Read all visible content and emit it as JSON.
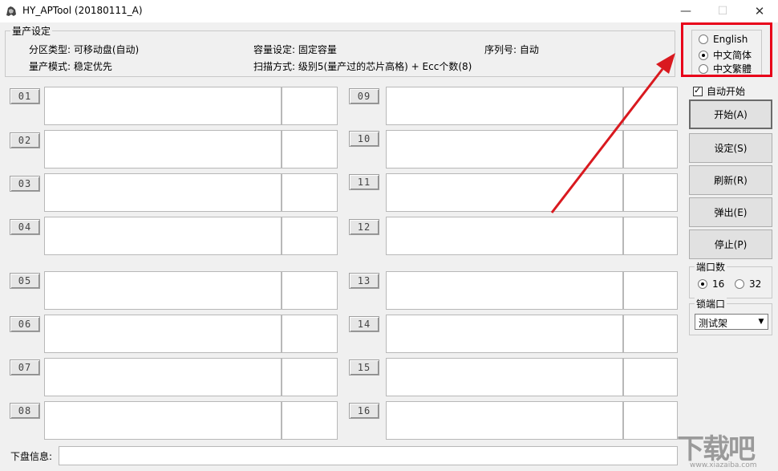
{
  "window": {
    "title": "HY_APTool (20180111_A)",
    "min_icon": "minimize-icon",
    "max_icon": "maximize-icon",
    "close_icon": "close-icon"
  },
  "production_settings": {
    "legend": "量产设定",
    "partition_type": "分区类型: 可移动盘(自动)",
    "capacity_setting": "容量设定: 固定容量",
    "serial_number": "序列号:  自动",
    "production_mode": "量产模式: 稳定优先",
    "scan_mode": "扫描方式: 级别5(量产过的芯片高格) + Ecc个数(8)"
  },
  "ports": [
    "01",
    "02",
    "03",
    "04",
    "05",
    "06",
    "07",
    "08",
    "09",
    "10",
    "11",
    "12",
    "13",
    "14",
    "15",
    "16"
  ],
  "disk_info": {
    "label": "下盘信息:",
    "value": ""
  },
  "language": {
    "options": [
      "English",
      "中文简体",
      "中文繁體"
    ],
    "selected": "中文简体"
  },
  "auto_start": {
    "label": "自动开始",
    "checked": true
  },
  "buttons": {
    "start": "开始(A)",
    "settings": "设定(S)",
    "refresh": "刷新(R)",
    "eject": "弹出(E)",
    "stop": "停止(P)"
  },
  "port_count": {
    "legend": "端口数",
    "options": [
      "16",
      "32"
    ],
    "selected": "16"
  },
  "lock_port": {
    "legend": "锁端口",
    "selected": "测试架"
  },
  "watermark": {
    "text": "下载吧",
    "url": "www.xiazaiba.com"
  },
  "colors": {
    "highlight": "#e8001a",
    "background": "#f0f0f0"
  }
}
